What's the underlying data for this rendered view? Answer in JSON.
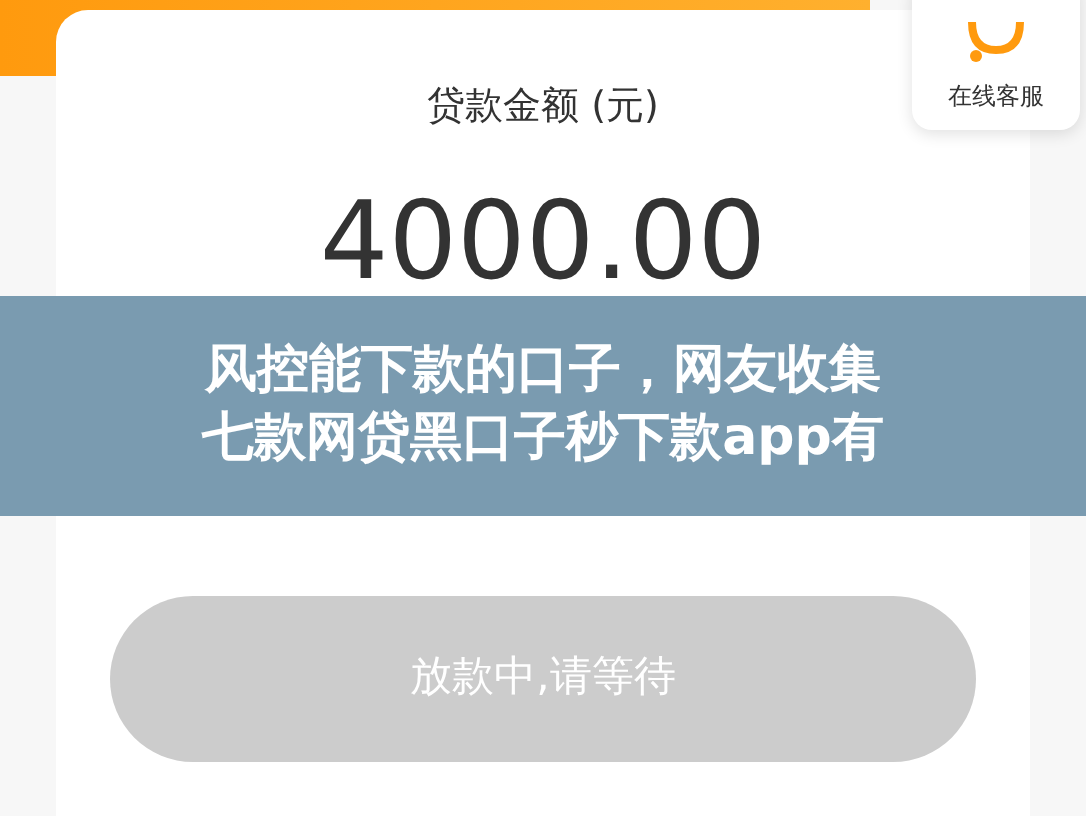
{
  "service": {
    "label": "在线客服"
  },
  "loan": {
    "label": "贷款金额 (元)",
    "amount": "4000.00"
  },
  "submit_button": {
    "label": "放款中,请等待",
    "disabled": true
  },
  "caption": {
    "lines": [
      "风控能下款的口子，网友收集",
      "七款网贷黑口子秒下款app有"
    ]
  }
}
